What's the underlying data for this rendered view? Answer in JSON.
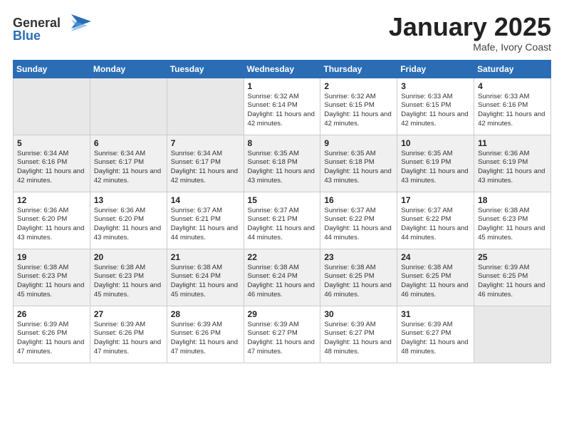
{
  "logo": {
    "line1": "General",
    "line2": "Blue"
  },
  "title": "January 2025",
  "subtitle": "Mafe, Ivory Coast",
  "weekdays": [
    "Sunday",
    "Monday",
    "Tuesday",
    "Wednesday",
    "Thursday",
    "Friday",
    "Saturday"
  ],
  "weeks": [
    [
      {
        "day": "",
        "empty": true
      },
      {
        "day": "",
        "empty": true
      },
      {
        "day": "",
        "empty": true
      },
      {
        "day": "1",
        "sunrise": "6:32 AM",
        "sunset": "6:14 PM",
        "daylight": "11 hours and 42 minutes."
      },
      {
        "day": "2",
        "sunrise": "6:32 AM",
        "sunset": "6:15 PM",
        "daylight": "11 hours and 42 minutes."
      },
      {
        "day": "3",
        "sunrise": "6:33 AM",
        "sunset": "6:15 PM",
        "daylight": "11 hours and 42 minutes."
      },
      {
        "day": "4",
        "sunrise": "6:33 AM",
        "sunset": "6:16 PM",
        "daylight": "11 hours and 42 minutes."
      }
    ],
    [
      {
        "day": "5",
        "sunrise": "6:34 AM",
        "sunset": "6:16 PM",
        "daylight": "11 hours and 42 minutes."
      },
      {
        "day": "6",
        "sunrise": "6:34 AM",
        "sunset": "6:17 PM",
        "daylight": "11 hours and 42 minutes."
      },
      {
        "day": "7",
        "sunrise": "6:34 AM",
        "sunset": "6:17 PM",
        "daylight": "11 hours and 42 minutes."
      },
      {
        "day": "8",
        "sunrise": "6:35 AM",
        "sunset": "6:18 PM",
        "daylight": "11 hours and 43 minutes."
      },
      {
        "day": "9",
        "sunrise": "6:35 AM",
        "sunset": "6:18 PM",
        "daylight": "11 hours and 43 minutes."
      },
      {
        "day": "10",
        "sunrise": "6:35 AM",
        "sunset": "6:19 PM",
        "daylight": "11 hours and 43 minutes."
      },
      {
        "day": "11",
        "sunrise": "6:36 AM",
        "sunset": "6:19 PM",
        "daylight": "11 hours and 43 minutes."
      }
    ],
    [
      {
        "day": "12",
        "sunrise": "6:36 AM",
        "sunset": "6:20 PM",
        "daylight": "11 hours and 43 minutes."
      },
      {
        "day": "13",
        "sunrise": "6:36 AM",
        "sunset": "6:20 PM",
        "daylight": "11 hours and 43 minutes."
      },
      {
        "day": "14",
        "sunrise": "6:37 AM",
        "sunset": "6:21 PM",
        "daylight": "11 hours and 44 minutes."
      },
      {
        "day": "15",
        "sunrise": "6:37 AM",
        "sunset": "6:21 PM",
        "daylight": "11 hours and 44 minutes."
      },
      {
        "day": "16",
        "sunrise": "6:37 AM",
        "sunset": "6:22 PM",
        "daylight": "11 hours and 44 minutes."
      },
      {
        "day": "17",
        "sunrise": "6:37 AM",
        "sunset": "6:22 PM",
        "daylight": "11 hours and 44 minutes."
      },
      {
        "day": "18",
        "sunrise": "6:38 AM",
        "sunset": "6:23 PM",
        "daylight": "11 hours and 45 minutes."
      }
    ],
    [
      {
        "day": "19",
        "sunrise": "6:38 AM",
        "sunset": "6:23 PM",
        "daylight": "11 hours and 45 minutes."
      },
      {
        "day": "20",
        "sunrise": "6:38 AM",
        "sunset": "6:23 PM",
        "daylight": "11 hours and 45 minutes."
      },
      {
        "day": "21",
        "sunrise": "6:38 AM",
        "sunset": "6:24 PM",
        "daylight": "11 hours and 45 minutes."
      },
      {
        "day": "22",
        "sunrise": "6:38 AM",
        "sunset": "6:24 PM",
        "daylight": "11 hours and 46 minutes."
      },
      {
        "day": "23",
        "sunrise": "6:38 AM",
        "sunset": "6:25 PM",
        "daylight": "11 hours and 46 minutes."
      },
      {
        "day": "24",
        "sunrise": "6:38 AM",
        "sunset": "6:25 PM",
        "daylight": "11 hours and 46 minutes."
      },
      {
        "day": "25",
        "sunrise": "6:39 AM",
        "sunset": "6:25 PM",
        "daylight": "11 hours and 46 minutes."
      }
    ],
    [
      {
        "day": "26",
        "sunrise": "6:39 AM",
        "sunset": "6:26 PM",
        "daylight": "11 hours and 47 minutes."
      },
      {
        "day": "27",
        "sunrise": "6:39 AM",
        "sunset": "6:26 PM",
        "daylight": "11 hours and 47 minutes."
      },
      {
        "day": "28",
        "sunrise": "6:39 AM",
        "sunset": "6:26 PM",
        "daylight": "11 hours and 47 minutes."
      },
      {
        "day": "29",
        "sunrise": "6:39 AM",
        "sunset": "6:27 PM",
        "daylight": "11 hours and 47 minutes."
      },
      {
        "day": "30",
        "sunrise": "6:39 AM",
        "sunset": "6:27 PM",
        "daylight": "11 hours and 48 minutes."
      },
      {
        "day": "31",
        "sunrise": "6:39 AM",
        "sunset": "6:27 PM",
        "daylight": "11 hours and 48 minutes."
      },
      {
        "day": "",
        "empty": true
      }
    ]
  ],
  "labels": {
    "sunrise": "Sunrise:",
    "sunset": "Sunset:",
    "daylight": "Daylight:"
  }
}
